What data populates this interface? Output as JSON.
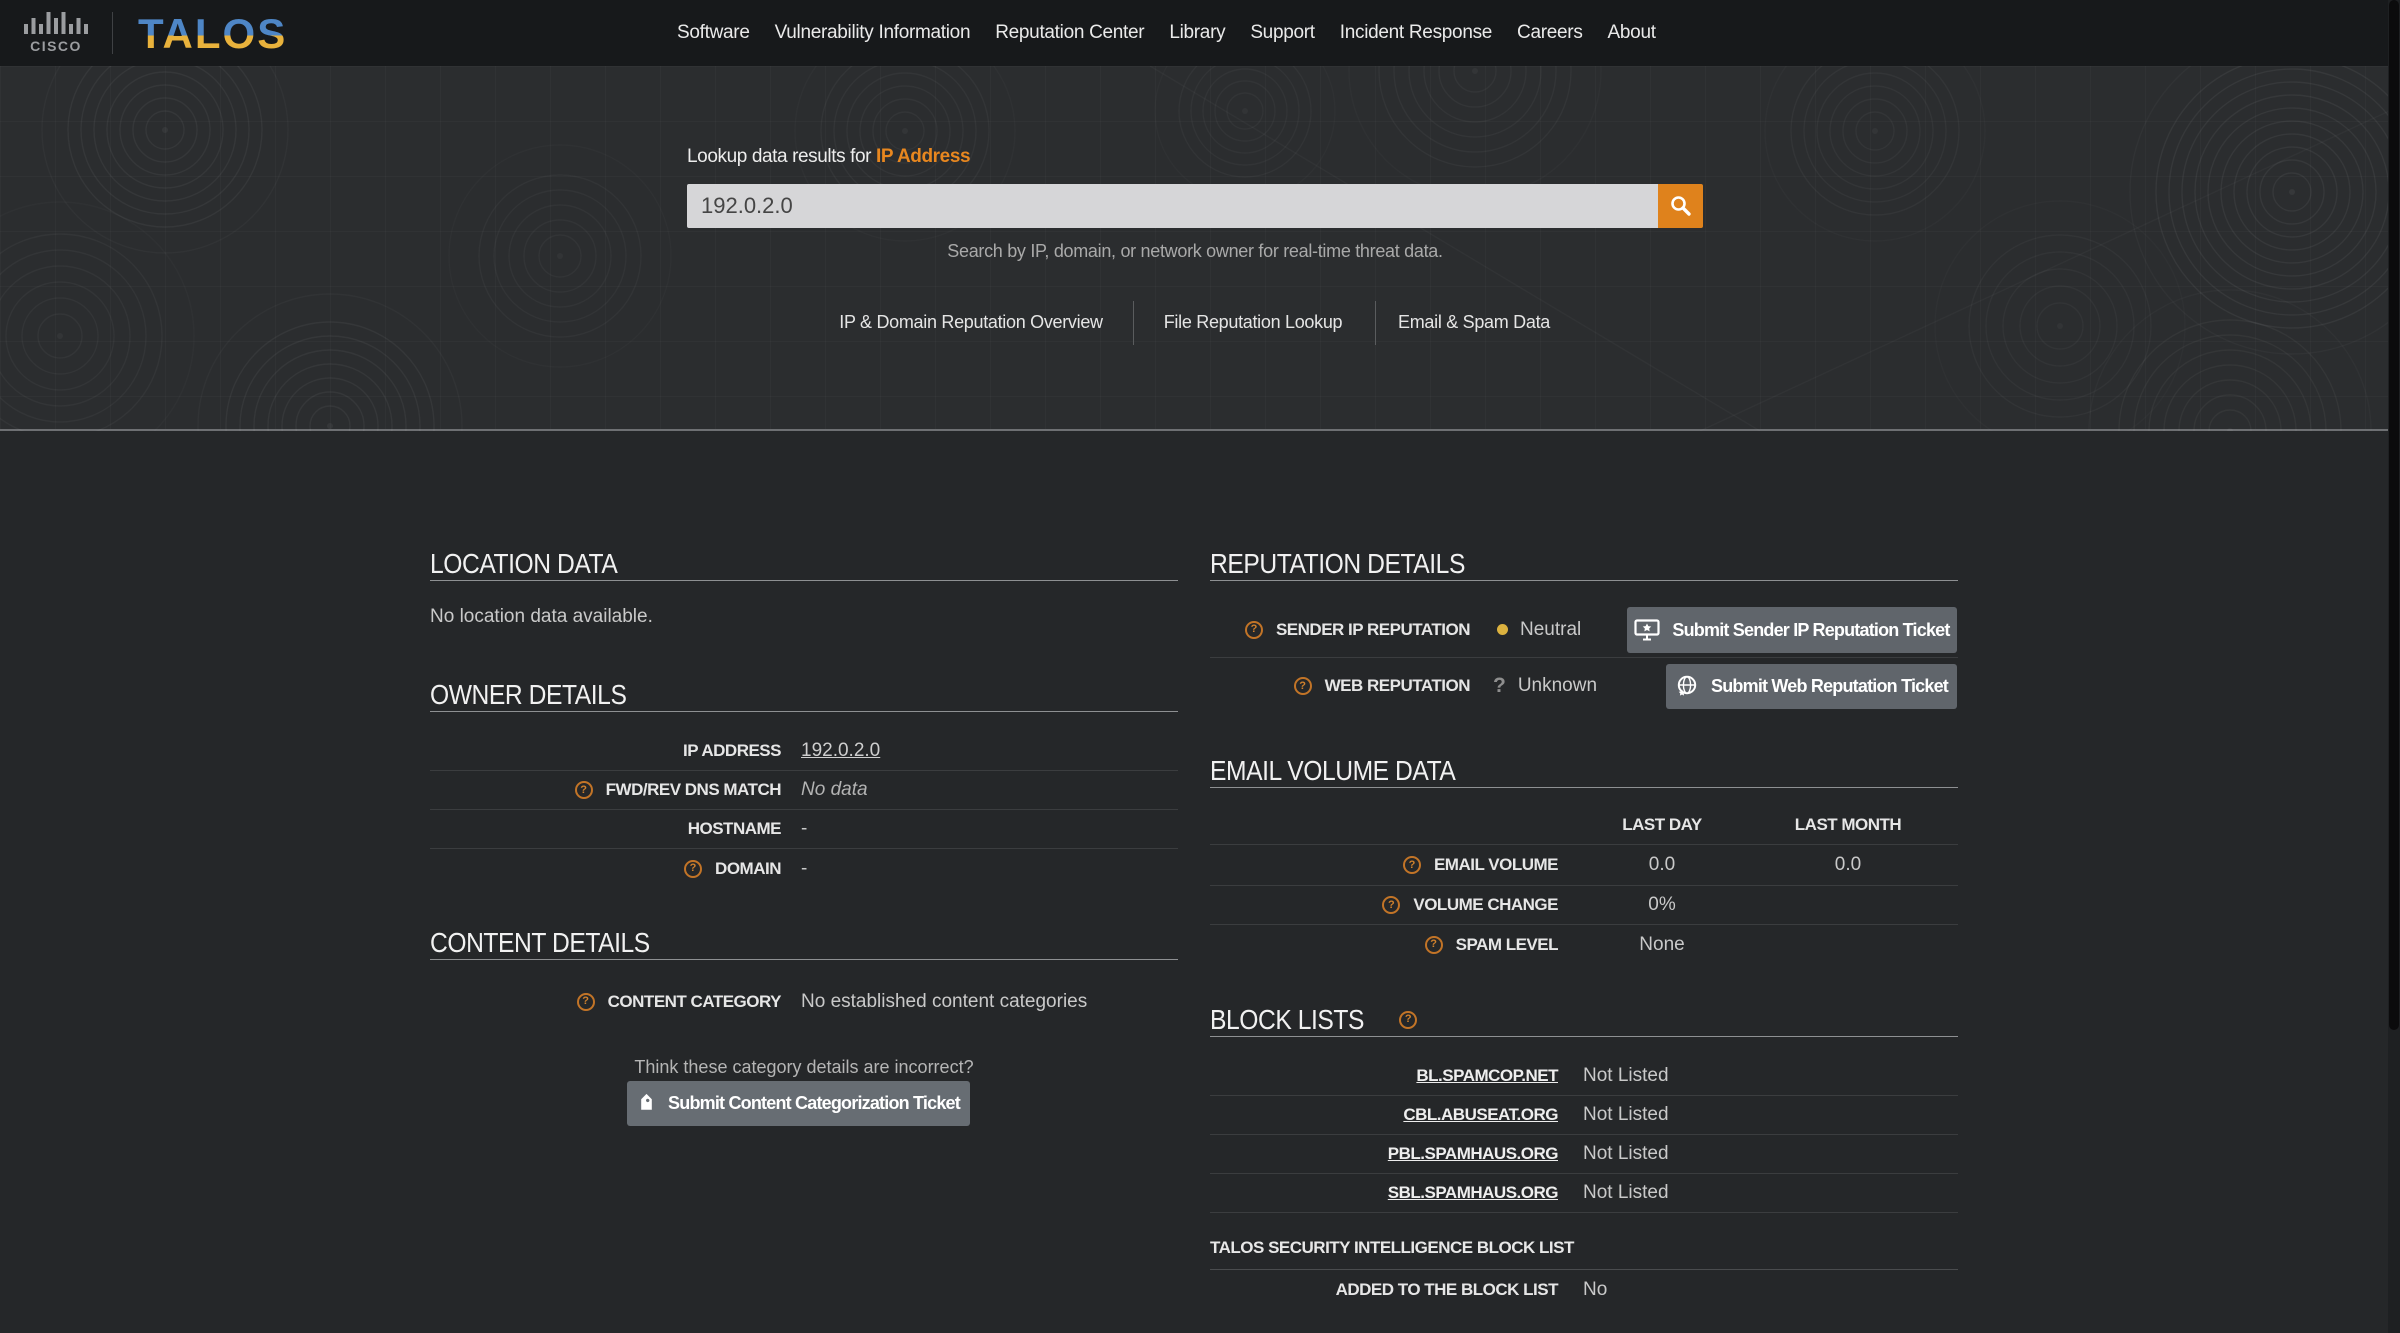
{
  "brand": {
    "cisco": "CISCO",
    "talos": "TALOS"
  },
  "nav": {
    "items": [
      "Software",
      "Vulnerability Information",
      "Reputation Center",
      "Library",
      "Support",
      "Incident Response",
      "Careers",
      "About"
    ]
  },
  "hero": {
    "lookup_prefix": "Lookup data results for ",
    "lookup_type": "IP Address",
    "search_value": "192.0.2.0",
    "search_hint": "Search by IP, domain, or network owner for real-time threat data.",
    "links": [
      "IP & Domain Reputation Overview",
      "File Reputation Lookup",
      "Email & Spam Data"
    ]
  },
  "location": {
    "title": "LOCATION DATA",
    "empty_text": "No location data available."
  },
  "owner": {
    "title": "OWNER DETAILS",
    "rows": [
      {
        "label": "IP ADDRESS",
        "value": "192.0.2.0"
      },
      {
        "label": "FWD/REV DNS MATCH",
        "value": "No data"
      },
      {
        "label": "HOSTNAME",
        "value": "-"
      },
      {
        "label": "DOMAIN",
        "value": "-"
      }
    ]
  },
  "content_details": {
    "title": "CONTENT DETAILS",
    "category_label": "CONTENT CATEGORY",
    "category_value": "No established content categories",
    "think_text": "Think these category details are incorrect?",
    "submit_label": "Submit Content Categorization Ticket"
  },
  "reputation": {
    "title": "REPUTATION DETAILS",
    "sender_label": "SENDER IP REPUTATION",
    "sender_status": "Neutral",
    "sender_button": "Submit Sender IP Reputation Ticket",
    "web_label": "WEB REPUTATION",
    "web_status": "Unknown",
    "web_button": "Submit Web Reputation Ticket"
  },
  "email_volume": {
    "title": "EMAIL VOLUME DATA",
    "col_last_day": "LAST DAY",
    "col_last_month": "LAST MONTH",
    "rows": [
      {
        "label": "EMAIL VOLUME",
        "day": "0.0",
        "month": "0.0"
      },
      {
        "label": "VOLUME CHANGE",
        "day": "0%",
        "month": ""
      },
      {
        "label": "SPAM LEVEL",
        "day": "None",
        "month": ""
      }
    ]
  },
  "block_lists": {
    "title": "BLOCK LISTS",
    "rows": [
      {
        "label": "BL.SPAMCOP.NET",
        "value": "Not Listed"
      },
      {
        "label": "CBL.ABUSEAT.ORG",
        "value": "Not Listed"
      },
      {
        "label": "PBL.SPAMHAUS.ORG",
        "value": "Not Listed"
      },
      {
        "label": "SBL.SPAMHAUS.ORG",
        "value": "Not Listed"
      }
    ],
    "talos_subtitle": "TALOS SECURITY INTELLIGENCE BLOCK LIST",
    "added_label": "ADDED TO THE BLOCK LIST",
    "added_value": "No"
  },
  "colors": {
    "accent_orange": "#e2831e",
    "status_yellow": "#dcb23f"
  }
}
